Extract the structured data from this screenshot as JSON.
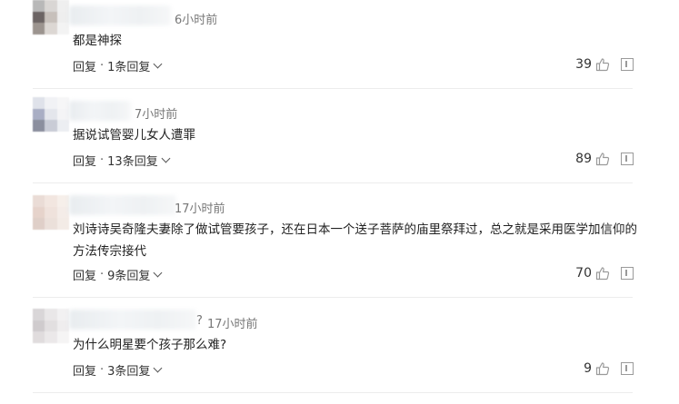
{
  "comments": [
    {
      "time": "6小时前",
      "text": "都是神探",
      "reply_label": "回复",
      "separator": "·",
      "replies_label": "1条回复",
      "likes": "39",
      "avatar_colors": [
        "#b8b8b8",
        "#d9d6d4",
        "#efefef",
        "#6c6464",
        "#c7c0bb",
        "#eeeeee",
        "#9c948f",
        "#dcd7d3",
        "#f3f3f3"
      ]
    },
    {
      "time": "7小时前",
      "text": "据说试管婴儿女人遭罪",
      "reply_label": "回复",
      "separator": "·",
      "replies_label": "13条回复",
      "likes": "89",
      "avatar_colors": [
        "#dfe2ea",
        "#f1f2f5",
        "#f6f6f7",
        "#a9aec4",
        "#e4e6ec",
        "#f4f4f6",
        "#8b8f9e",
        "#c9ccd6",
        "#eceef2"
      ]
    },
    {
      "time": "17小时前",
      "text": "刘诗诗吴奇隆夫妻除了做试管要孩子，还在日本一个送子菩萨的庙里祭拜过，总之就是采用医学加信仰的方法传宗接代",
      "reply_label": "回复",
      "separator": "·",
      "replies_label": "9条回复",
      "likes": "70",
      "avatar_colors": [
        "#eadcd6",
        "#f2e6e0",
        "#f6efea",
        "#e6d3cb",
        "#efe2dc",
        "#f4ece8",
        "#dfcfc8",
        "#ebe0da",
        "#f3ebe6"
      ]
    },
    {
      "time": "17小时前",
      "time_prefix": "?",
      "text": "为什么明星要个孩子那么难?",
      "reply_label": "回复",
      "separator": "·",
      "replies_label": "3条回复",
      "likes": "9",
      "avatar_colors": [
        "#d9d6d8",
        "#e9e7e8",
        "#f2f1f2",
        "#cfcbcd",
        "#e2dfe0",
        "#efedee",
        "#e0dcdd",
        "#ebe8e9",
        "#f5f4f4"
      ]
    }
  ],
  "icons": {
    "like": "thumbs-up-icon",
    "report": "report-icon",
    "expand": "chevron-down-icon"
  },
  "colors": {
    "text": "#222222",
    "meta": "#777777",
    "icon": "#9a9a9a",
    "divider": "#ececec"
  }
}
